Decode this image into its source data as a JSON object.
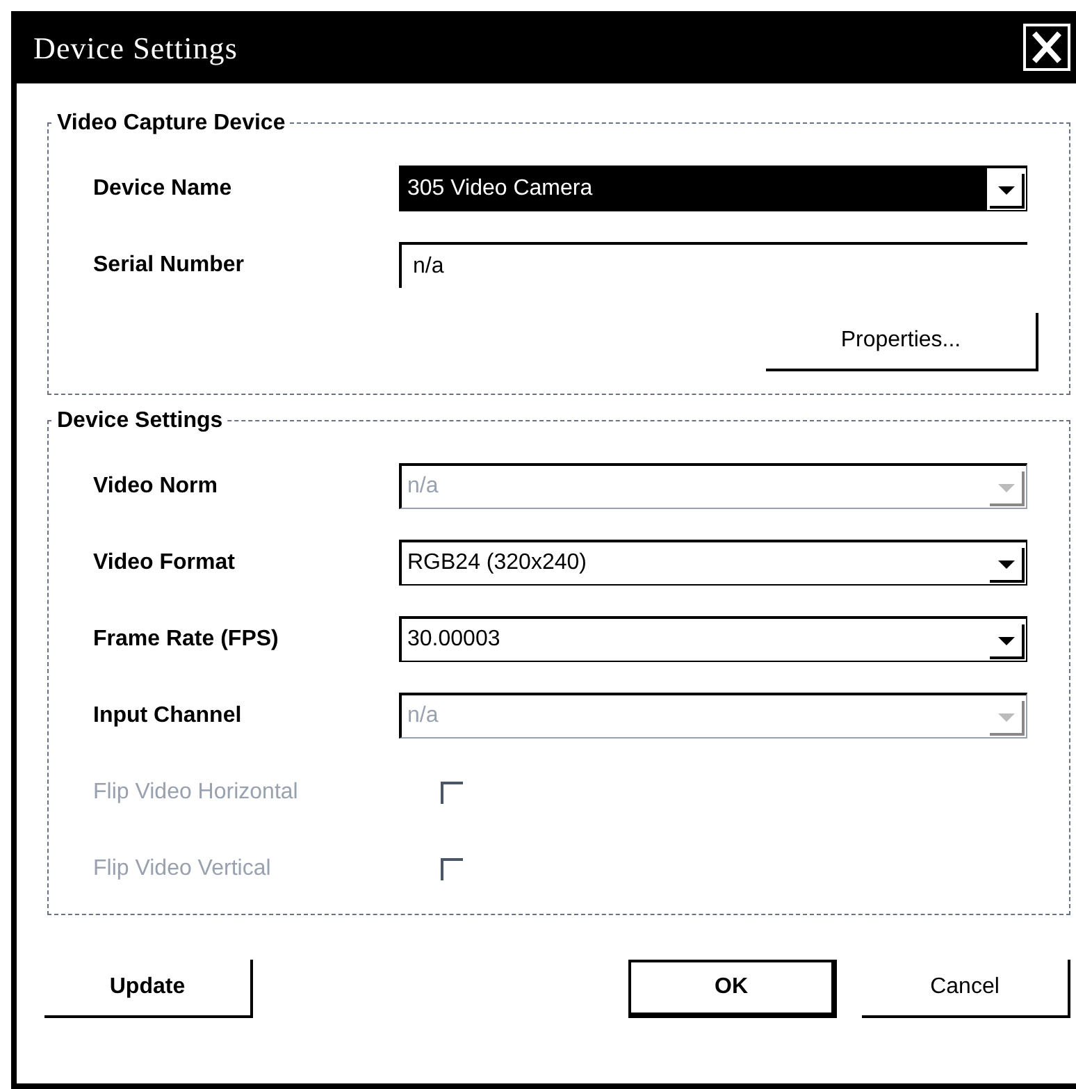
{
  "window": {
    "title": "Device Settings"
  },
  "groups": [
    {
      "title": "Video Capture Device",
      "rows": [
        {
          "kind": "dropdown",
          "label": "Device Name",
          "value": "305 Video Camera",
          "disabled": false,
          "highlighted": true
        },
        {
          "kind": "text",
          "label": "Serial Number",
          "value": "n/a"
        }
      ],
      "button": "Properties..."
    },
    {
      "title": "Device Settings",
      "rows": [
        {
          "kind": "dropdown",
          "label": "Video Norm",
          "value": "n/a",
          "disabled": true,
          "highlighted": false
        },
        {
          "kind": "dropdown",
          "label": "Video Format",
          "value": "RGB24 (320x240)",
          "disabled": false,
          "highlighted": false
        },
        {
          "kind": "dropdown",
          "label": "Frame Rate (FPS)",
          "value": "30.00003",
          "disabled": false,
          "highlighted": false
        },
        {
          "kind": "dropdown",
          "label": "Input Channel",
          "value": "n/a",
          "disabled": true,
          "highlighted": false
        },
        {
          "kind": "checkbox",
          "label": "Flip Video Horizontal",
          "checked": false,
          "disabled": true
        },
        {
          "kind": "checkbox",
          "label": "Flip Video Vertical",
          "checked": false,
          "disabled": true
        }
      ]
    }
  ],
  "buttons": [
    {
      "label": "Update",
      "default": false
    },
    {
      "label": "OK",
      "default": true
    },
    {
      "label": "Cancel",
      "default": false
    }
  ]
}
